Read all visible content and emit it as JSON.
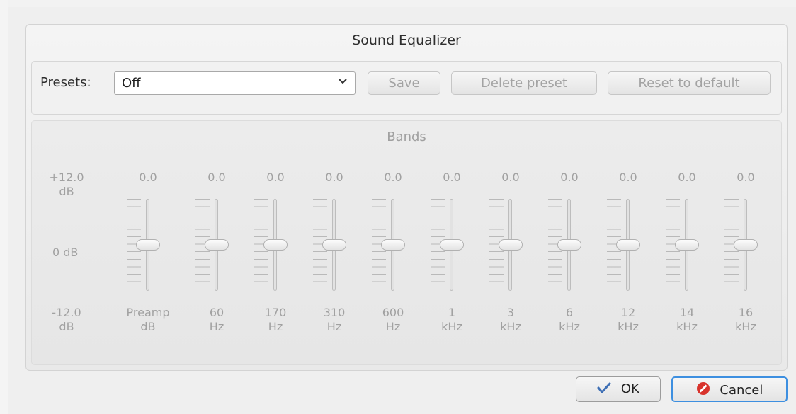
{
  "dialog": {
    "title": "Sound Equalizer",
    "presets_label": "Presets:",
    "preset_value": "Off",
    "save_label": "Save",
    "delete_label": "Delete preset",
    "reset_label": "Reset to default",
    "bands_title": "Bands",
    "scale": {
      "top": [
        "+12.0",
        "dB"
      ],
      "mid": "0 dB",
      "bottom": [
        "-12.0",
        "dB"
      ]
    },
    "bands": [
      {
        "value": "0.0",
        "label1": "Preamp",
        "label2": "dB",
        "level": 0
      },
      {
        "value": "0.0",
        "label1": "60",
        "label2": "Hz",
        "level": 0
      },
      {
        "value": "0.0",
        "label1": "170",
        "label2": "Hz",
        "level": 0
      },
      {
        "value": "0.0",
        "label1": "310",
        "label2": "Hz",
        "level": 0
      },
      {
        "value": "0.0",
        "label1": "600",
        "label2": "Hz",
        "level": 0
      },
      {
        "value": "0.0",
        "label1": "1",
        "label2": "kHz",
        "level": 0
      },
      {
        "value": "0.0",
        "label1": "3",
        "label2": "kHz",
        "level": 0
      },
      {
        "value": "0.0",
        "label1": "6",
        "label2": "kHz",
        "level": 0
      },
      {
        "value": "0.0",
        "label1": "12",
        "label2": "kHz",
        "level": 0
      },
      {
        "value": "0.0",
        "label1": "14",
        "label2": "kHz",
        "level": 0
      },
      {
        "value": "0.0",
        "label1": "16",
        "label2": "kHz",
        "level": 0
      }
    ],
    "ok_label": "OK",
    "cancel_label": "Cancel"
  },
  "icons": {
    "ok": "checkmark-icon",
    "cancel": "cancel-icon",
    "dropdown": "chevron-down-icon"
  },
  "colors": {
    "accent": "#3d8fe0",
    "cancel_icon": "#d8332c",
    "ok_icon": "#3e6fb5"
  }
}
